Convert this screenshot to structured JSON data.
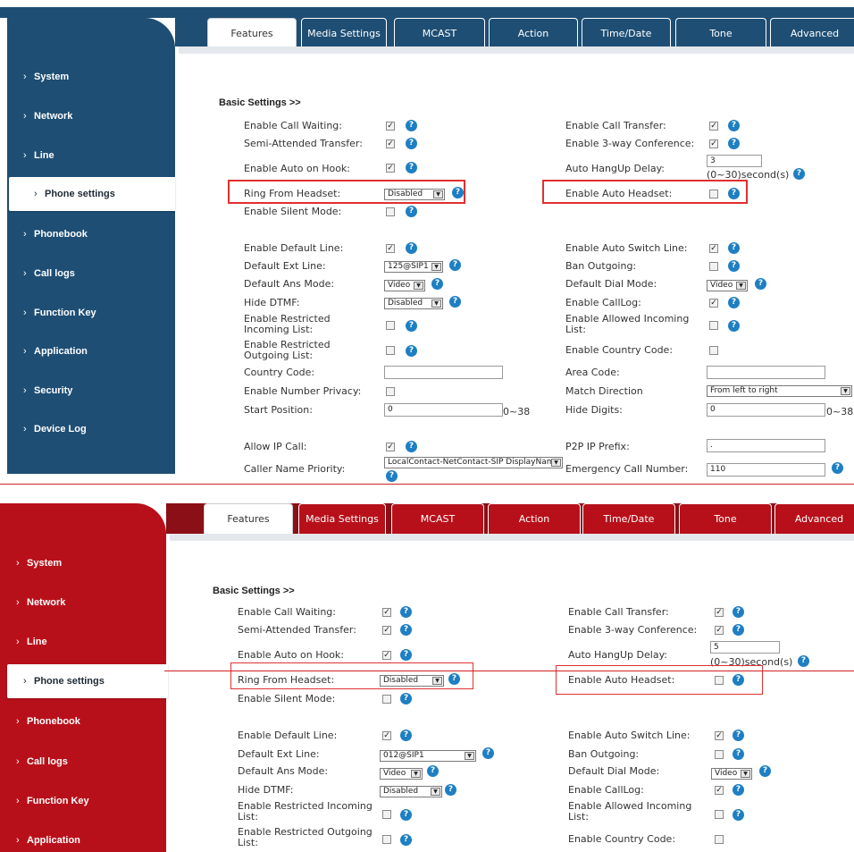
{
  "panel1": {
    "tabs": [
      "Features",
      "Media Settings",
      "MCAST",
      "Action",
      "Time/Date",
      "Tone",
      "Advanced"
    ],
    "sidebar": [
      "System",
      "Network",
      "Line",
      "Phone settings",
      "Phonebook",
      "Call logs",
      "Function Key",
      "Application",
      "Security",
      "Device Log"
    ],
    "section_title": "Basic Settings >>",
    "labels": {
      "call_waiting": "Enable Call Waiting:",
      "semi_attended": "Semi-Attended Transfer:",
      "auto_on_hook": "Enable Auto on Hook:",
      "ring_from_headset": "Ring From Headset:",
      "silent_mode": "Enable Silent Mode:",
      "default_line": "Enable Default Line:",
      "default_ext_line": "Default Ext Line:",
      "default_ans_mode": "Default Ans Mode:",
      "hide_dtmf": "Hide DTMF:",
      "restricted_incoming": "Enable Restricted Incoming List:",
      "restricted_outgoing": "Enable Restricted Outgoing List:",
      "country_code": "Country Code:",
      "number_privacy": "Enable Number Privacy:",
      "start_position": "Start Position:",
      "allow_ip_call": "Allow IP Call:",
      "caller_name_priority": "Caller Name Priority:",
      "call_transfer": "Enable Call Transfer:",
      "three_way": "Enable 3-way Conference:",
      "auto_hangup_delay": "Auto HangUp Delay:",
      "auto_headset": "Enable Auto Headset:",
      "auto_switch_line": "Enable Auto Switch Line:",
      "ban_outgoing": "Ban Outgoing:",
      "default_dial_mode": "Default Dial Mode:",
      "call_log": "Enable CallLog:",
      "allowed_incoming": "Enable Allowed Incoming List:",
      "enable_country_code": "Enable Country Code:",
      "area_code": "Area Code:",
      "match_direction": "Match Direction",
      "hide_digits": "Hide Digits:",
      "p2p_prefix": "P2P IP Prefix:",
      "emergency_number": "Emergency Call Number:"
    },
    "values": {
      "ring_from_headset": "Disabled",
      "default_ext_line": "125@SIP1",
      "default_ans_mode": "Video",
      "hide_dtmf": "Disabled",
      "auto_hangup_delay": "3",
      "auto_hangup_range": "(0~30)second(s)",
      "default_dial_mode": "Video",
      "match_direction": "From left to right",
      "start_position": "0",
      "start_range": "0~38",
      "hide_digits": "0",
      "hide_range": "0~38",
      "p2p_prefix": ".",
      "emergency_number": "110",
      "caller_name_priority": "LocalContact-NetContact-SIP DisplayName"
    }
  },
  "panel2": {
    "tabs": [
      "Features",
      "Media Settings",
      "MCAST",
      "Action",
      "Time/Date",
      "Tone",
      "Advanced"
    ],
    "sidebar": [
      "System",
      "Network",
      "Line",
      "Phone settings",
      "Phonebook",
      "Call logs",
      "Function Key",
      "Application"
    ],
    "section_title": "Basic Settings >>",
    "values": {
      "ring_from_headset": "Disabled",
      "default_ext_line": "012@SIP1",
      "default_ans_mode": "Video",
      "hide_dtmf": "Disabled",
      "auto_hangup_delay": "5",
      "auto_hangup_range": "(0~30)second(s)",
      "default_dial_mode": "Video"
    }
  },
  "colors": {
    "blue_theme": "#1e4e74",
    "red_theme": "#b8101a",
    "help_icon": "#1e7fc2",
    "highlight": "#e03030"
  }
}
